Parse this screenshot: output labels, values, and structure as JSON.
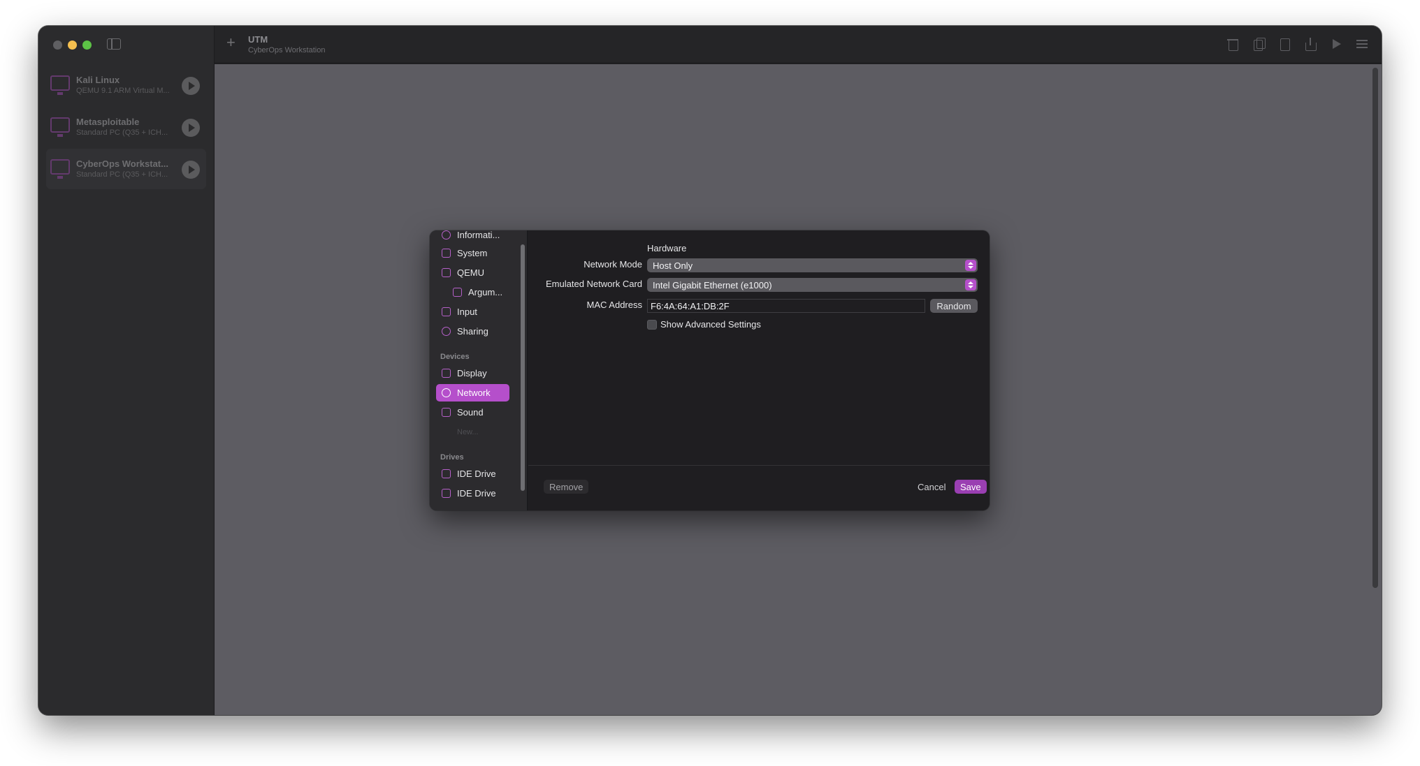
{
  "colors": {
    "accent": "#b54fcb",
    "primary_button": "#9a3fb2",
    "main_background": "#5d5c62",
    "dialog_background": "#1f1e21"
  },
  "vms": [
    {
      "name": "Kali Linux",
      "subtitle": "QEMU 9.1 ARM Virtual M...",
      "icon": "monitor-icon",
      "selected": false
    },
    {
      "name": "Metasploitable",
      "subtitle": "Standard PC (Q35 + ICH...",
      "icon": "monitor-icon",
      "selected": false
    },
    {
      "name": "CyberOps Workstat...",
      "subtitle": "Standard PC (Q35 + ICH...",
      "icon": "monitor-icon",
      "selected": true
    }
  ],
  "toolbar": {
    "title": "UTM",
    "subtitle": "CyberOps Workstation",
    "add_label": "+",
    "icons": [
      "trash-icon",
      "clone-icon",
      "document-icon",
      "share-icon",
      "play-icon",
      "settings-icon"
    ]
  },
  "dialog": {
    "nav": {
      "items": [
        {
          "label": "Informati...",
          "icon": "info-icon"
        },
        {
          "label": "System",
          "icon": "cpu-icon"
        },
        {
          "label": "QEMU",
          "icon": "cube-icon"
        },
        {
          "label": "Argum...",
          "icon": "arguments-icon"
        },
        {
          "label": "Input",
          "icon": "keyboard-icon"
        },
        {
          "label": "Sharing",
          "icon": "person-icon"
        }
      ],
      "devices_header": "Devices",
      "devices": [
        {
          "label": "Display",
          "icon": "display-icon"
        },
        {
          "label": "Network",
          "icon": "globe-icon",
          "active": true
        },
        {
          "label": "Sound",
          "icon": "speaker-icon"
        },
        {
          "label": "New...",
          "icon": ""
        }
      ],
      "drives_header": "Drives",
      "drives": [
        {
          "label": "IDE Drive",
          "icon": "drive-icon"
        },
        {
          "label": "IDE Drive",
          "icon": "drive-icon"
        }
      ]
    },
    "section_title": "Hardware",
    "network_mode": {
      "label": "Network Mode",
      "value": "Host Only"
    },
    "network_card": {
      "label": "Emulated Network Card",
      "value": "Intel Gigabit Ethernet (e1000)"
    },
    "mac": {
      "label": "MAC Address",
      "value": "F6:4A:64:A1:DB:2F",
      "random_label": "Random"
    },
    "advanced": {
      "label": "Show Advanced Settings",
      "checked": false
    },
    "footer": {
      "remove": "Remove",
      "cancel": "Cancel",
      "save": "Save"
    }
  }
}
